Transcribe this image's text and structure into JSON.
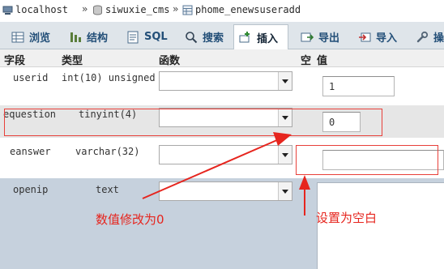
{
  "breadcrumb": {
    "items": [
      {
        "label": "localhost",
        "icon": "server-icon"
      },
      {
        "label": "siwuxie_cms",
        "icon": "database-icon"
      },
      {
        "label": "phome_enewsuseradd",
        "icon": "table-icon"
      }
    ],
    "separator": "»"
  },
  "tabs": [
    {
      "label": "浏览",
      "icon": "browse-icon"
    },
    {
      "label": "结构",
      "icon": "structure-icon"
    },
    {
      "label": "SQL",
      "icon": "sql-icon"
    },
    {
      "label": "搜索",
      "icon": "search-icon"
    },
    {
      "label": "插入",
      "icon": "insert-icon",
      "active": true
    },
    {
      "label": "导出",
      "icon": "export-icon"
    },
    {
      "label": "导入",
      "icon": "import-icon"
    },
    {
      "label": "操",
      "icon": "wrench-icon"
    }
  ],
  "table": {
    "headers": {
      "field": "字段",
      "type": "类型",
      "function": "函数",
      "null": "空",
      "value": "值"
    },
    "rows": [
      {
        "field": "userid",
        "type": "int(10) unsigned",
        "value": "1"
      },
      {
        "field": "equestion",
        "type": "tinyint(4)",
        "value": "0"
      },
      {
        "field": "eanswer",
        "type": "varchar(32)",
        "value": ""
      },
      {
        "field": "openip",
        "type": "text",
        "value": ""
      }
    ]
  },
  "annotations": {
    "left": "数值修改为0",
    "right": "设置为空白"
  },
  "colors": {
    "annotation": "#e6251e",
    "tab_text": "#234f78",
    "highlight_row": "#e6e6e6",
    "selected_row": "#c6d1dd"
  }
}
